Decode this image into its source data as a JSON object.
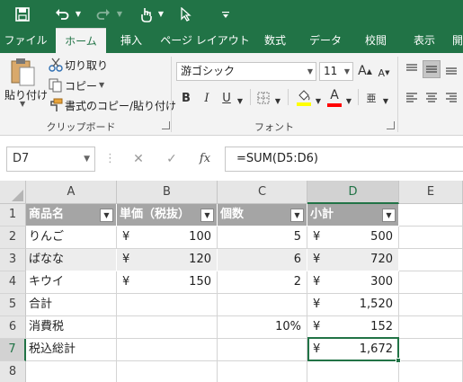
{
  "quick_access": {
    "save_icon": "save-icon",
    "undo_icon": "undo-icon",
    "redo_icon": "redo-icon",
    "touch_icon": "touch-mode-icon",
    "pointer_icon": "pointer-icon",
    "customize_icon": "customize-icon"
  },
  "tabs": [
    "ファイル",
    "ホーム",
    "挿入",
    "ページ レイアウト",
    "数式",
    "データ",
    "校閲",
    "表示",
    "開"
  ],
  "ribbon": {
    "paste_label": "貼り付け",
    "cut_label": "切り取り",
    "copy_label": "コピー",
    "format_painter_label": "書式のコピー/貼り付け",
    "clipboard_group": "クリップボード",
    "font_name": "游ゴシック",
    "font_size": "11",
    "grow_font": "A",
    "shrink_font": "A",
    "bold": "B",
    "italic": "I",
    "underline": "U",
    "font_color_glyph": "A",
    "phonetic_glyph": "亜",
    "font_group": "フォント",
    "fill_color": "#ffff00",
    "font_color": "#ff0000"
  },
  "formula_bar": {
    "name_box": "D7",
    "cancel": "✕",
    "enter": "✓",
    "fx": "fx",
    "formula": "=SUM(D5:D6)"
  },
  "sheet": {
    "columns": [
      "A",
      "B",
      "C",
      "D",
      "E"
    ],
    "rows": [
      "1",
      "2",
      "3",
      "4",
      "5",
      "6",
      "7",
      "8"
    ],
    "header": [
      "商品名",
      "単価（税抜）",
      "個数",
      "小計"
    ],
    "data": [
      {
        "name": "りんご",
        "price_yen": "¥",
        "price": "100",
        "qty": "5",
        "sub_yen": "¥",
        "sub": "500"
      },
      {
        "name": "ばなな",
        "price_yen": "¥",
        "price": "120",
        "qty": "6",
        "sub_yen": "¥",
        "sub": "720"
      },
      {
        "name": "キウイ",
        "price_yen": "¥",
        "price": "150",
        "qty": "2",
        "sub_yen": "¥",
        "sub": "300"
      }
    ],
    "total_label": "合計",
    "total_yen": "¥",
    "total": "1,520",
    "tax_label": "消費税",
    "tax_rate": "10%",
    "tax_yen": "¥",
    "tax": "152",
    "grand_label": "税込総計",
    "grand_yen": "¥",
    "grand": "1,672"
  },
  "colors": {
    "accent": "#217346",
    "table_header": "#a5a5a5",
    "table_band": "#ededed"
  }
}
